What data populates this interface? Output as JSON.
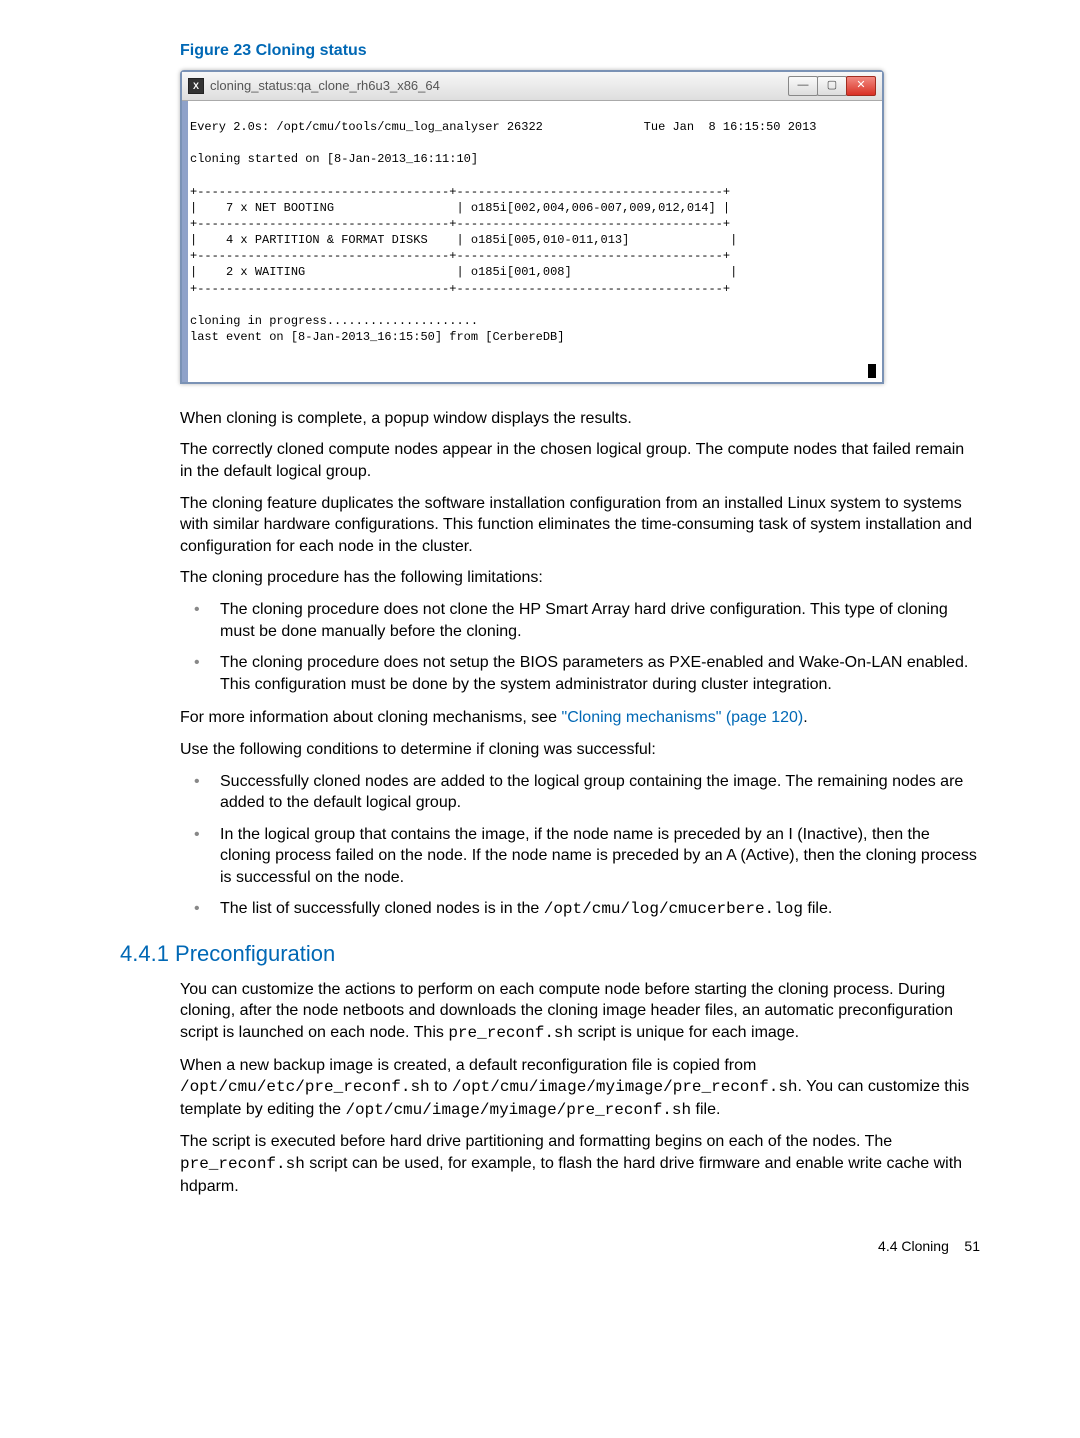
{
  "figure": {
    "label": "Figure 23 Cloning status"
  },
  "window": {
    "title": "cloning_status:qa_clone_rh6u3_x86_64",
    "icon_text": "X"
  },
  "terminal": {
    "topline": "Every 2.0s: /opt/cmu/tools/cmu_log_analyser 26322              Tue Jan  8 16:15:50 2013",
    "started": "cloning started on [8-Jan-2013_16:11:10]",
    "rows": [
      {
        "left": "   7 x NET BOOTING",
        "right": "o185i[002,004,006-007,009,012,014]"
      },
      {
        "left": "   4 x PARTITION & FORMAT DISKS",
        "right": "o185i[005,010-011,013]"
      },
      {
        "left": "   2 x WAITING",
        "right": "o185i[001,008]"
      }
    ],
    "progress": "cloning in progress.....................",
    "lastevent": "last event on [8-Jan-2013_16:15:50] from [CerbereDB]"
  },
  "paras": {
    "p1": "When cloning is complete, a popup window displays the results.",
    "p2": "The correctly cloned compute nodes appear in the chosen logical group. The compute nodes that failed remain in the default logical group.",
    "p3": "The cloning feature duplicates the software installation configuration from an installed Linux system to systems with similar hardware configurations. This function eliminates the time-consuming task of system installation and configuration for each node in the cluster.",
    "p4": "The cloning procedure has the following limitations:",
    "bullets1": {
      "b1": "The cloning procedure does not clone the HP Smart Array hard drive configuration. This type of cloning must be done manually before the cloning.",
      "b2": "The cloning procedure does not setup the BIOS parameters as PXE-enabled and Wake-On-LAN enabled. This configuration must be done by the system administrator during cluster integration."
    },
    "p5_pre": "For more information about cloning mechanisms, see ",
    "p5_link": "\"Cloning mechanisms\" (page 120)",
    "p5_post": ".",
    "p6": "Use the following conditions to determine if cloning was successful:",
    "bullets2": {
      "b1": "Successfully cloned nodes are added to the logical group containing the image. The remaining nodes are added to the default logical group.",
      "b2": "In the logical group that contains the image, if the node name is preceded by an I (Inactive), then the cloning process failed on the node. If the node name is preceded by an A (Active), then the cloning process is successful on the node.",
      "b3_pre": "The list of successfully cloned nodes is in the ",
      "b3_code": "/opt/cmu/log/cmucerbere.log",
      "b3_post": " file."
    }
  },
  "section441": {
    "heading": "4.4.1 Preconfiguration",
    "p1_pre": "You can customize the actions to perform on each compute node before starting the cloning process. During cloning, after the node netboots and downloads the cloning image header files, an automatic preconfiguration script is launched on each node. This ",
    "p1_code": "pre_reconf.sh",
    "p1_post": " script is unique for each image.",
    "p2_pre": "When a new backup image is created, a default reconfiguration file is copied from ",
    "p2_code1": "/opt/cmu/etc/pre_reconf.sh",
    "p2_mid": " to ",
    "p2_code2": "/opt/cmu/image/myimage/pre_reconf.sh",
    "p2_post1": ". You can customize this template by editing the ",
    "p2_code3": "/opt/cmu/image/myimage/pre_reconf.sh",
    "p2_post2": " file.",
    "p3_pre": "The script is executed before hard drive partitioning and formatting begins on each of the nodes. The ",
    "p3_code": "pre_reconf.sh",
    "p3_post": " script can be used, for example, to flash the hard drive firmware and enable write cache with hdparm."
  },
  "footer": {
    "section": "4.4 Cloning",
    "page": "51"
  }
}
